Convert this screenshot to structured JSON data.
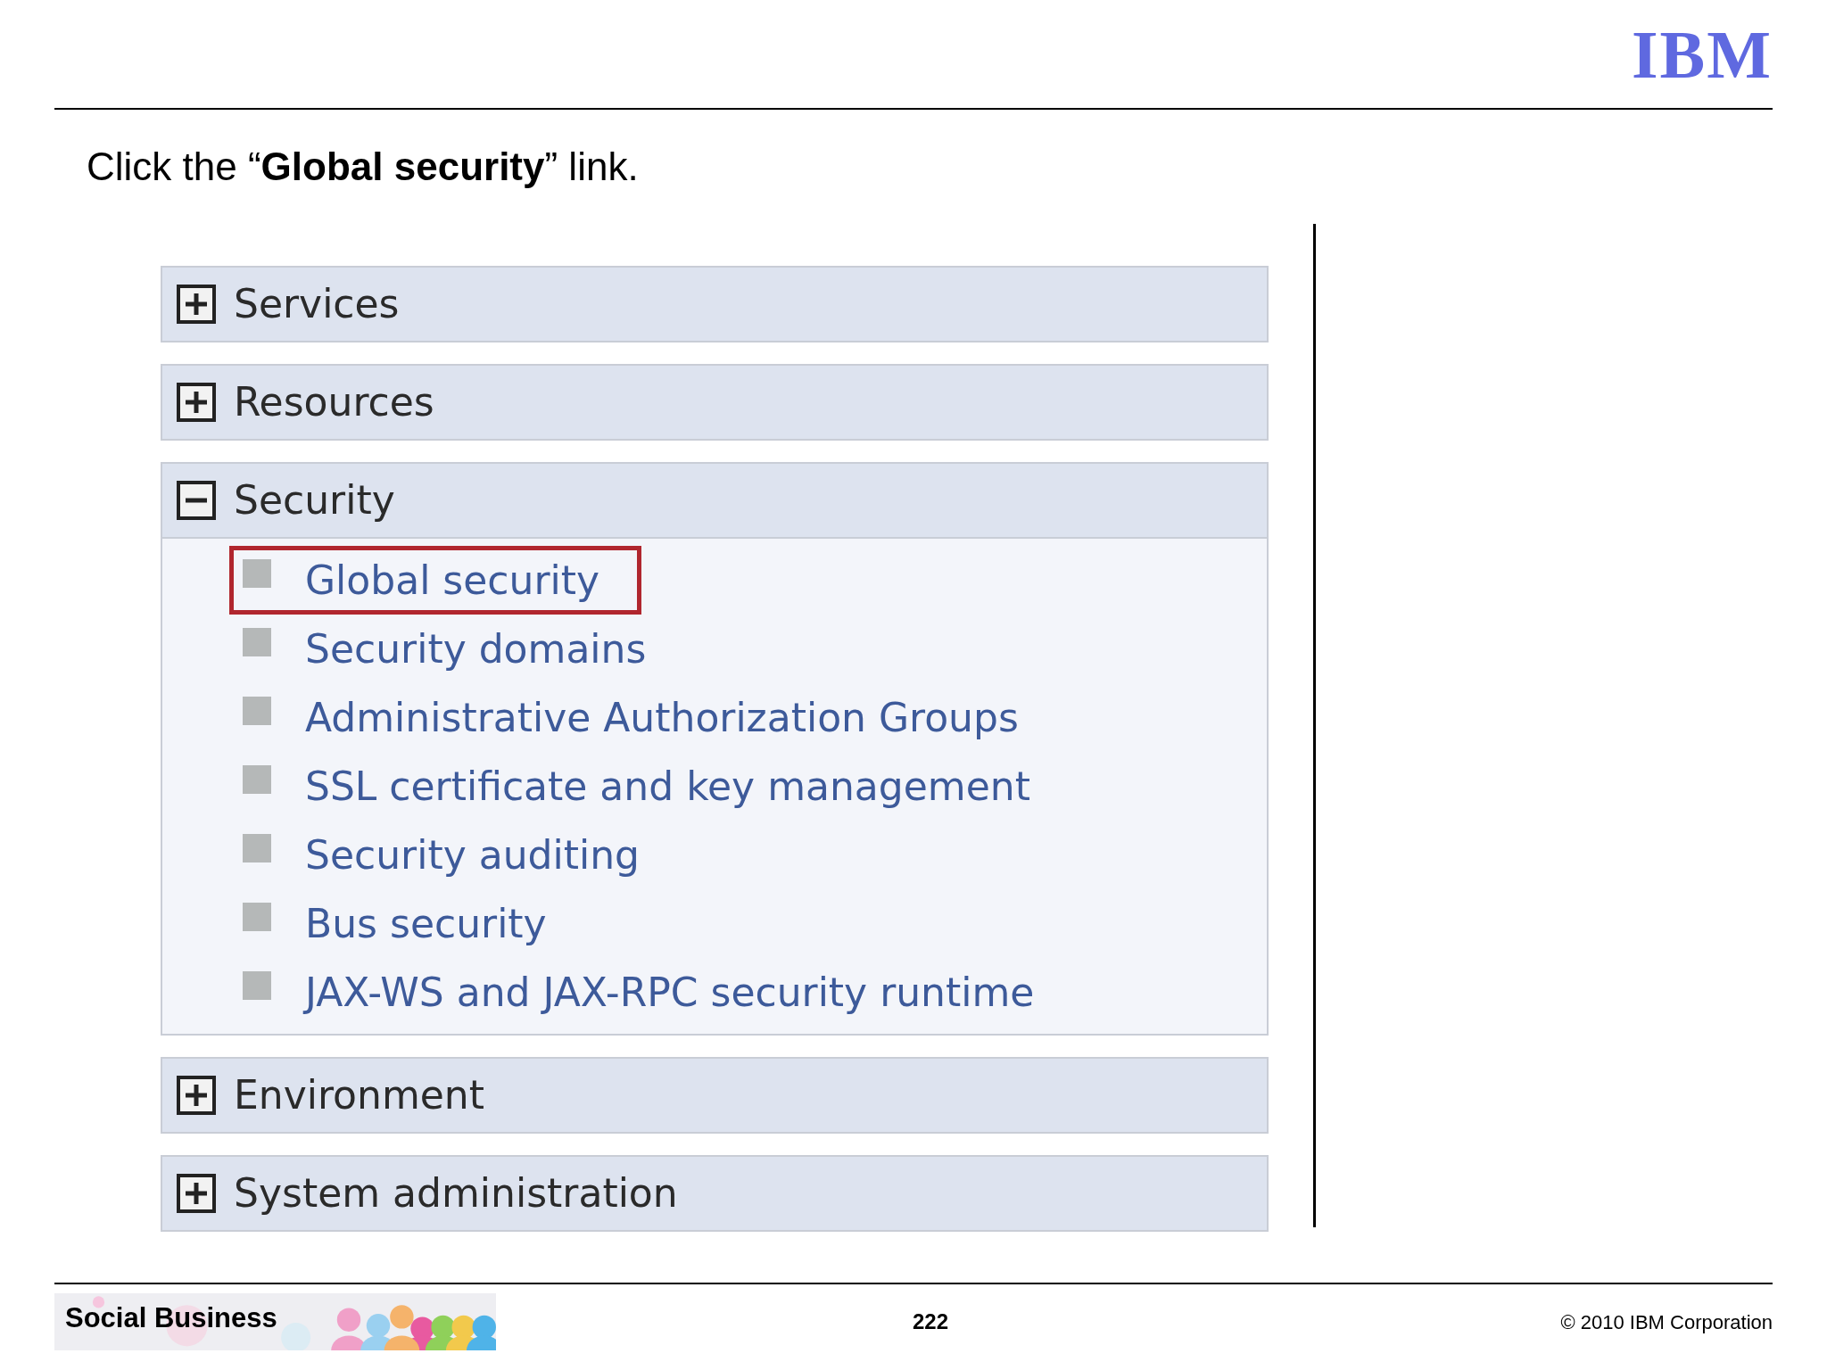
{
  "slide": {
    "logo": "IBM",
    "instruction": "Click the “**Global security**” link."
  },
  "navigation": [
    {
      "label": "Services",
      "expanded": false
    },
    {
      "label": "Resources",
      "expanded": false
    },
    {
      "label": "Security",
      "expanded": true,
      "children": [
        {
          "label": "Global security",
          "highlighted": true
        },
        {
          "label": "Security domains",
          "highlighted": false
        },
        {
          "label": "Administrative Authorization Groups",
          "highlighted": false
        },
        {
          "label": "SSL certificate and key management",
          "highlighted": false
        },
        {
          "label": "Security auditing",
          "highlighted": false
        },
        {
          "label": "Bus security",
          "highlighted": false
        },
        {
          "label": "JAX-WS and JAX-RPC security runtime",
          "highlighted": false
        }
      ]
    },
    {
      "label": "Environment",
      "expanded": false
    },
    {
      "label": "System administration",
      "expanded": false
    }
  ],
  "footer": {
    "banner": "Social Business",
    "page": "222",
    "copyright": "© 2010 IBM Corporation"
  }
}
